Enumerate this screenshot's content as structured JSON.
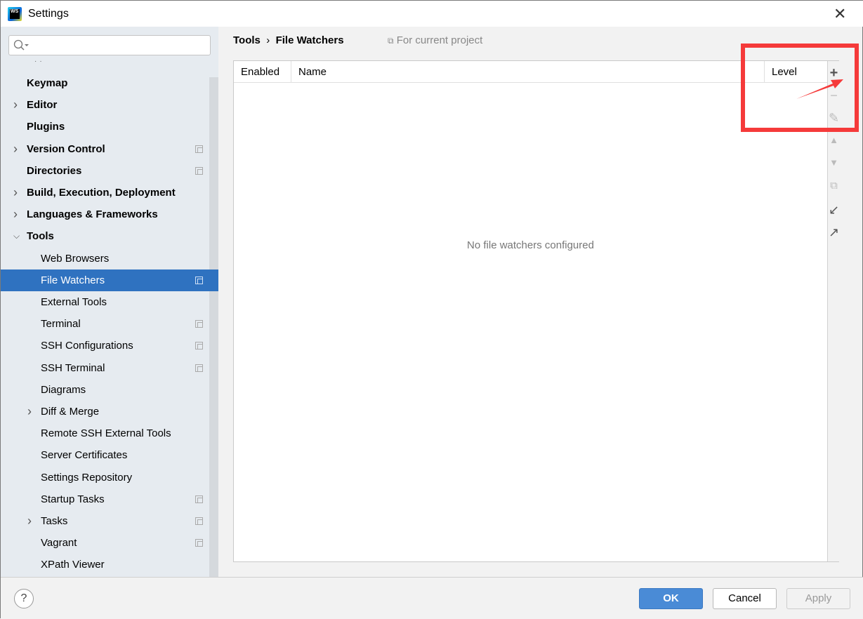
{
  "window": {
    "title": "Settings",
    "logo": "WS"
  },
  "search": {
    "placeholder": ""
  },
  "sidebar": {
    "items": [
      {
        "label": "Keymap",
        "bold": true,
        "expandable": false,
        "indent": 0,
        "project": false
      },
      {
        "label": "Editor",
        "bold": true,
        "expandable": true,
        "indent": 0,
        "project": false
      },
      {
        "label": "Plugins",
        "bold": true,
        "expandable": false,
        "indent": 0,
        "project": false
      },
      {
        "label": "Version Control",
        "bold": true,
        "expandable": true,
        "indent": 0,
        "project": true
      },
      {
        "label": "Directories",
        "bold": true,
        "expandable": false,
        "indent": 0,
        "project": true
      },
      {
        "label": "Build, Execution, Deployment",
        "bold": true,
        "expandable": true,
        "indent": 0,
        "project": false
      },
      {
        "label": "Languages & Frameworks",
        "bold": true,
        "expandable": true,
        "indent": 0,
        "project": false
      },
      {
        "label": "Tools",
        "bold": true,
        "expandable": true,
        "expanded": true,
        "indent": 0,
        "project": false
      },
      {
        "label": "Web Browsers",
        "indent": 1,
        "project": false
      },
      {
        "label": "File Watchers",
        "indent": 1,
        "project": true,
        "selected": true
      },
      {
        "label": "External Tools",
        "indent": 1,
        "project": false
      },
      {
        "label": "Terminal",
        "indent": 1,
        "project": true
      },
      {
        "label": "SSH Configurations",
        "indent": 1,
        "project": true
      },
      {
        "label": "SSH Terminal",
        "indent": 1,
        "project": true
      },
      {
        "label": "Diagrams",
        "indent": 1,
        "project": false
      },
      {
        "label": "Diff & Merge",
        "indent": 1,
        "expandable": true,
        "project": false
      },
      {
        "label": "Remote SSH External Tools",
        "indent": 1,
        "project": false
      },
      {
        "label": "Server Certificates",
        "indent": 1,
        "project": false
      },
      {
        "label": "Settings Repository",
        "indent": 1,
        "project": false
      },
      {
        "label": "Startup Tasks",
        "indent": 1,
        "project": true
      },
      {
        "label": "Tasks",
        "indent": 1,
        "expandable": true,
        "project": true
      },
      {
        "label": "Vagrant",
        "indent": 1,
        "project": true
      },
      {
        "label": "XPath Viewer",
        "indent": 1,
        "project": false
      }
    ]
  },
  "breadcrumb": {
    "parent": "Tools",
    "separator": "›",
    "current": "File Watchers"
  },
  "scope": "For current project",
  "table": {
    "columns": [
      "Enabled",
      "Name",
      "Level"
    ],
    "empty_text": "No file watchers configured"
  },
  "toolbar": [
    "plus-icon",
    "minus-icon",
    "edit-icon",
    "move-up-icon",
    "move-down-icon",
    "copy-icon",
    "import-icon",
    "export-icon"
  ],
  "buttons": {
    "ok": "OK",
    "cancel": "Cancel",
    "apply": "Apply",
    "help": "?"
  },
  "colors": {
    "accent": "#2f72c0",
    "annotation": "#f53a3a"
  }
}
